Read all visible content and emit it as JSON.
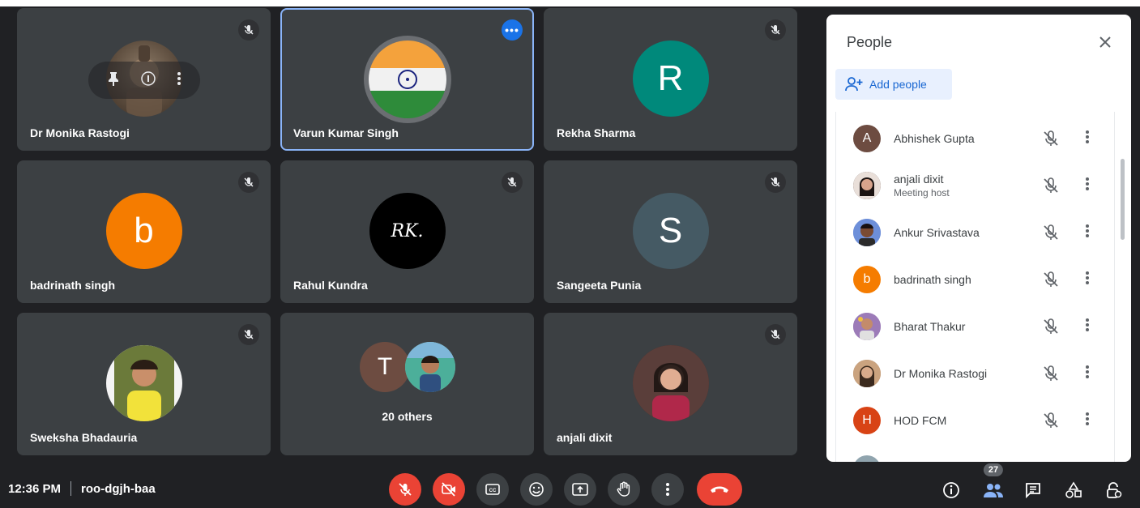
{
  "meeting": {
    "time": "12:36 PM",
    "code": "roo-dgjh-baa"
  },
  "tiles": [
    {
      "name": "Dr Monika Rastogi"
    },
    {
      "name": "Varun Kumar Singh"
    },
    {
      "name": "Rekha Sharma",
      "initial": "R",
      "color": "#00897b"
    },
    {
      "name": "badrinath singh",
      "initial": "b",
      "color": "#f57c00"
    },
    {
      "name": "Rahul Kundra",
      "logo_text": "RK."
    },
    {
      "name": "Sangeeta Punia",
      "initial": "S",
      "color": "#455a64"
    },
    {
      "name": "Sweksha Bhadauria"
    },
    {
      "name": "",
      "others": "20 others",
      "initial": "T",
      "color": "#6d4c41"
    },
    {
      "name": "anjali dixit"
    }
  ],
  "people_panel": {
    "title": "People",
    "add_label": "Add people",
    "participants": [
      {
        "name": "Abhishek Gupta",
        "initial": "A",
        "color": "#6d4c41"
      },
      {
        "name": "anjali dixit",
        "role": "Meeting host"
      },
      {
        "name": "Ankur Srivastava"
      },
      {
        "name": "badrinath singh",
        "initial": "b",
        "color": "#f57c00"
      },
      {
        "name": "Bharat Thakur"
      },
      {
        "name": "Dr Monika Rastogi"
      },
      {
        "name": "HOD FCM",
        "initial": "H",
        "color": "#d84315"
      }
    ]
  },
  "toolbar": {
    "people_count": "27"
  },
  "icons": {
    "mic_off": "mic-off-icon",
    "cam_off": "camera-off-icon",
    "captions": "captions-icon",
    "emoji": "emoji-icon",
    "present": "present-icon",
    "raise_hand": "raise-hand-icon",
    "more": "more-vert-icon",
    "hangup": "hangup-icon",
    "info": "info-icon",
    "people": "people-icon",
    "chat": "chat-icon",
    "activities": "activities-icon",
    "host_controls": "host-controls-icon"
  },
  "colors": {
    "background": "#202124",
    "tile": "#3c4043",
    "danger": "#ea4335",
    "accent": "#1a73e8"
  }
}
